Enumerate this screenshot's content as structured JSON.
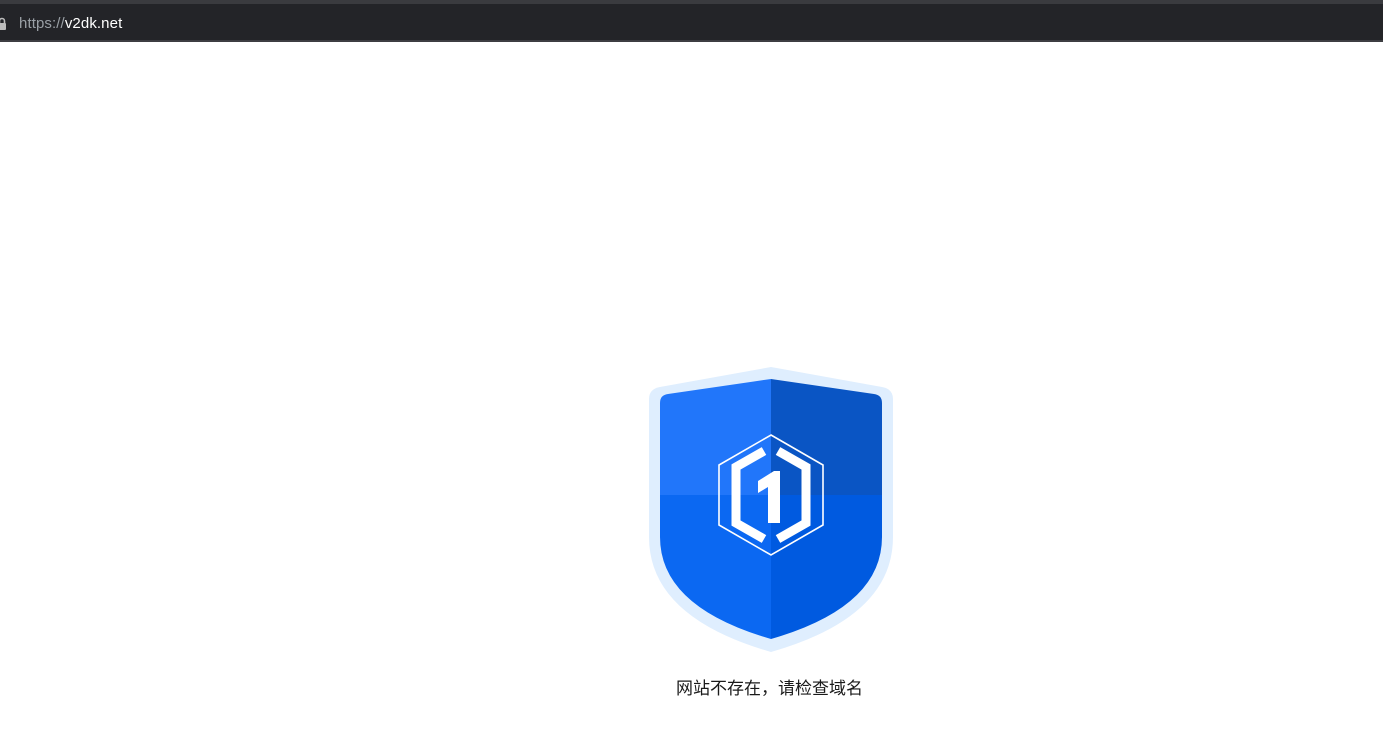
{
  "browser": {
    "url_scheme": "https://",
    "url_host": "v2dk.net"
  },
  "page": {
    "message": "网站不存在，请检查域名"
  },
  "icons": {
    "lock": "lock-icon",
    "shield": "shield-logo-icon"
  },
  "colors": {
    "shield_outer": "#dfeefe",
    "shield_top_left": "#2176fa",
    "shield_top_right": "#0a55c4",
    "shield_bottom_left": "#0b68f2",
    "shield_bottom_right": "#005ae0"
  }
}
